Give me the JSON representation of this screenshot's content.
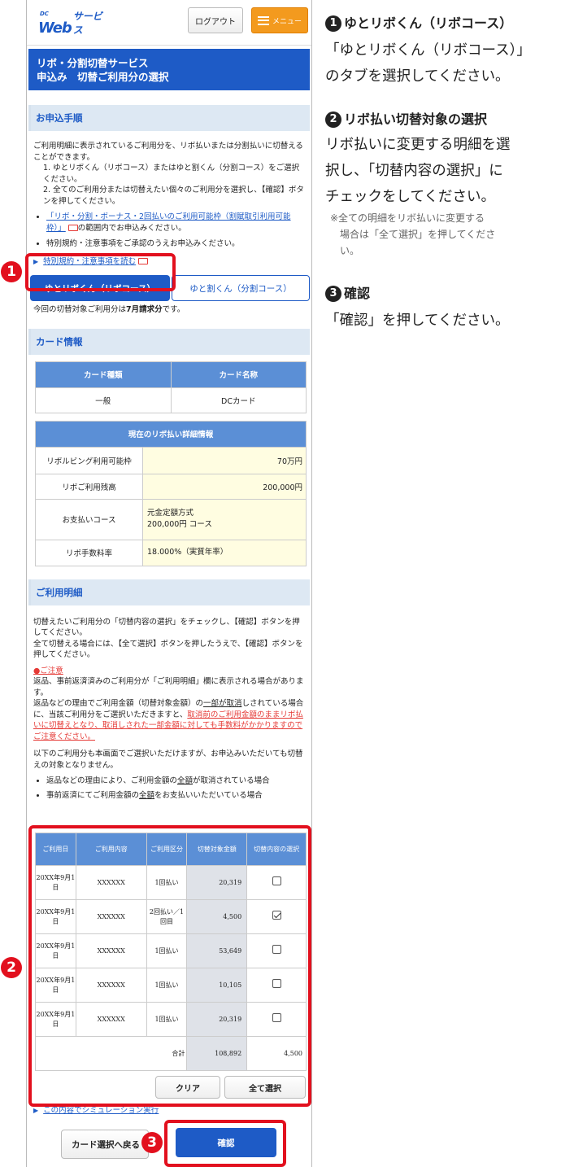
{
  "header": {
    "logo_small": "DC",
    "logo_main": "Web",
    "logo_sub": "サービス",
    "logout_label": "ログアウト",
    "menu_label": "メニュー"
  },
  "title": {
    "line1": "リボ・分割切替サービス",
    "line2": "申込み　切替ご利用分の選択"
  },
  "procedure": {
    "heading": "お申込手順",
    "intro": "ご利用明細に表示されているご利用分を、リボ払いまたは分割払いに切替えることができます。",
    "steps": [
      "1. ゆとリボくん（リボコース）またはゆと割くん（分割コース）をご選択ください。",
      "2. 全てのご利用分または切替えたい個々のご利用分を選択し、【確認】ボタンを押してください。"
    ],
    "bullet1_link": "「リボ・分割・ボーナス・2回払いのご利用可能枠（割賦取引利用可能枠）」",
    "bullet1_rest": "の範囲内でお申込みください。",
    "bullet2": "特別規約・注意事項をご承認のうえお申込みください。",
    "terms_link": "特別規約・注意事項を読む"
  },
  "tabs": {
    "active": "ゆとリボくん（リボコース）",
    "inactive": "ゆと割くん（分割コース）"
  },
  "billing_note": {
    "pre": "今回の切替対象ご利用分は",
    "bold": "7月請求分",
    "post": "です。"
  },
  "card": {
    "heading": "カード情報",
    "col_type": "カード種類",
    "col_name": "カード名称",
    "type": "一般",
    "name": "DCカード",
    "revo_heading": "現在のリボ払い詳細情報",
    "limit_label": "リボルビング利用可能枠",
    "limit_value": "70万円",
    "balance_label": "リボご利用残高",
    "balance_value": "200,000円",
    "course_label": "お支払いコース",
    "course_value1": "元金定額方式",
    "course_value2": "200,000円 コース",
    "fee_label": "リボ手数料率",
    "fee_value": "18.000%（実質年率）"
  },
  "usage": {
    "heading": "ご利用明細",
    "p1": "切替えたいご利用分の「切替内容の選択」をチェックし、【確認】ボタンを押してください。",
    "p2": "全て切替える場合には、【全て選択】ボタンを押したうえで、【確認】ボタンを押してください。",
    "caution_title": "●ご注意",
    "caution1": "返品、事前返済済みのご利用分が「ご利用明細」欄に表示される場合があります。",
    "caution2a": "返品などの理由でご利用金額（切替対象金額）の",
    "caution2b": "一部が取消",
    "caution2c": "しされている場合に、当該ご利用分をご選択いただきますと、",
    "caution2d": "取消前のご利用金額のままリボ払いに切替えとなり、取消しされた一部金額に対しても手数料がかかりますのでご注意ください。",
    "p3": "以下のご利用分も本画面でご選択いただけますが、お申込みいただいても切替えの対象となりません。",
    "b1a": "返品などの理由により、ご利用金額の",
    "b1b": "全額",
    "b1c": "が取消されている場合",
    "b2a": "事前返済にてご利用金額の",
    "b2b": "全額",
    "b2c": "をお支払いいただいている場合",
    "columns": [
      "ご利用日",
      "ご利用内容",
      "ご利用区分",
      "切替対象金額",
      "切替内容の選択"
    ],
    "rows": [
      {
        "date": "20XX年9月1日",
        "content": "XXXXXX",
        "kind": "1回払い",
        "amount": "20,319",
        "checked": false
      },
      {
        "date": "20XX年9月1日",
        "content": "XXXXXX",
        "kind": "2回払い／1回目",
        "amount": "4,500",
        "checked": true
      },
      {
        "date": "20XX年9月1日",
        "content": "XXXXXX",
        "kind": "1回払い",
        "amount": "53,649",
        "checked": false
      },
      {
        "date": "20XX年9月1日",
        "content": "XXXXXX",
        "kind": "1回払い",
        "amount": "10,105",
        "checked": false
      },
      {
        "date": "20XX年9月1日",
        "content": "XXXXXX",
        "kind": "1回払い",
        "amount": "20,319",
        "checked": false
      }
    ],
    "total_label": "合計",
    "total_amount": "108,892",
    "total_selected": "4,500",
    "clear_label": "クリア",
    "select_all_label": "全て選択",
    "sim_link": "この内容でシミュレーション実行",
    "back_label": "カード選択へ戻る",
    "confirm_label": "確認"
  },
  "guide": {
    "n1": "1",
    "h1": "ゆとリボくん（リボコース）",
    "p1a": "「ゆとリボくん（リボコース）」",
    "p1b": "のタブを選択してください。",
    "n2": "2",
    "h2": "リボ払い切替対象の選択",
    "p2a": "リボ払いに変更する明細を選",
    "p2b": "択し、「切替内容の選択」に",
    "p2c": "チェックをしてください。",
    "note2a": "※全ての明細をリボ払いに変更する",
    "note2b": "場合は「全て選択」を押してくださ",
    "note2c": "い。",
    "n3": "3",
    "h3": "確認",
    "p3": "「確認」を押してください。"
  },
  "colors": {
    "brand_blue": "#1e5bc6",
    "menu_orange": "#f39a1e",
    "highlight_red": "#e2101e"
  }
}
